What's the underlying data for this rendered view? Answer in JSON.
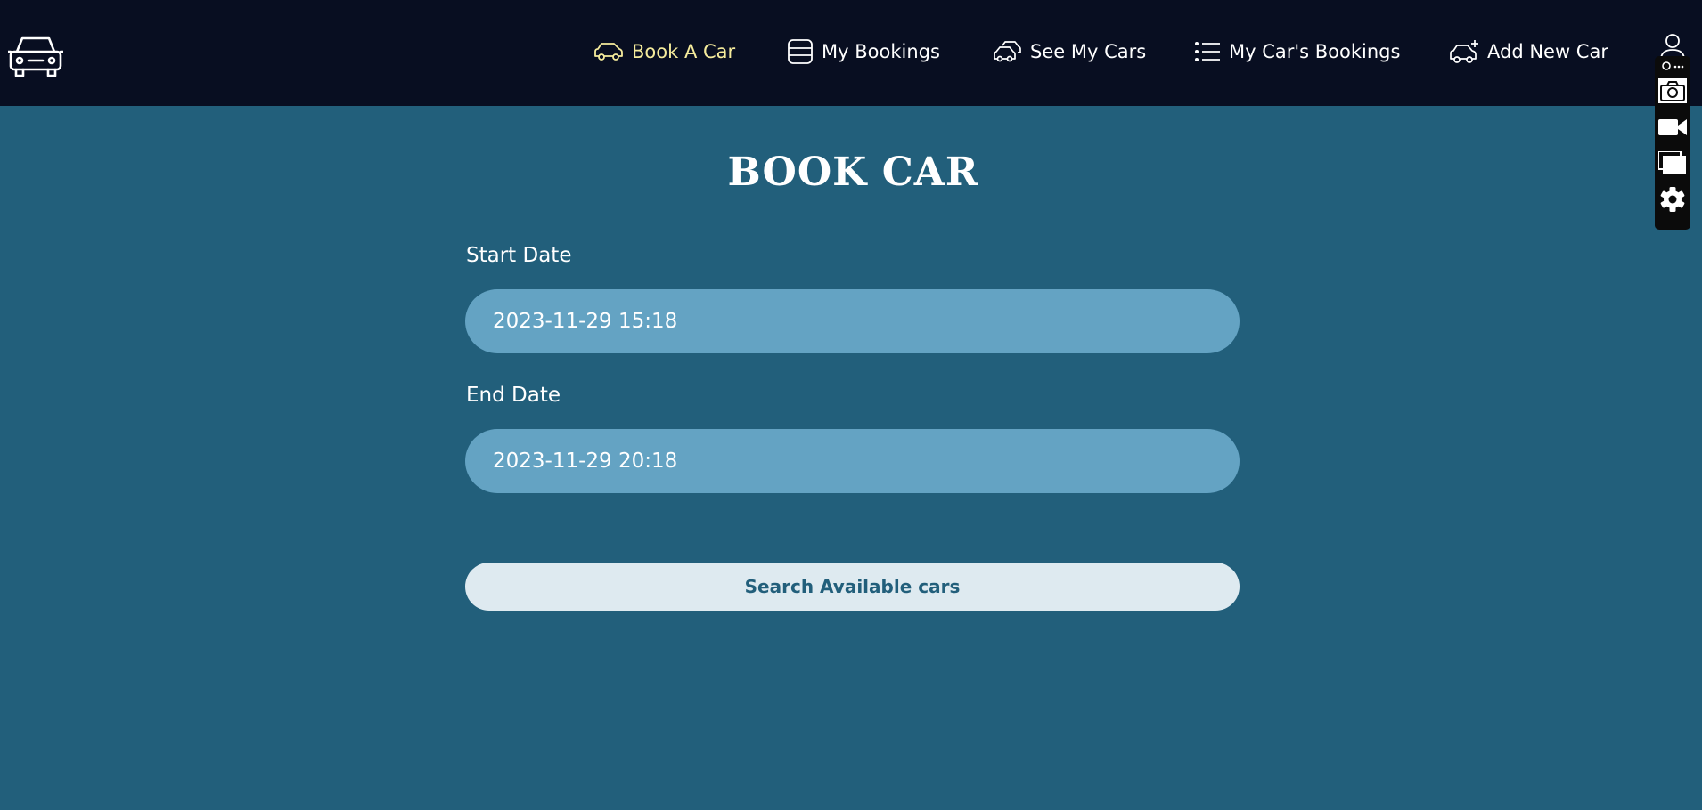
{
  "nav": {
    "items": [
      {
        "label": "Book A Car",
        "icon": "car-icon",
        "active": true
      },
      {
        "label": "My Bookings",
        "icon": "list-box-icon",
        "active": false
      },
      {
        "label": "See My Cars",
        "icon": "cars-icon",
        "active": false
      },
      {
        "label": "My Car's Bookings",
        "icon": "bullet-list-icon",
        "active": false
      },
      {
        "label": "Add New Car",
        "icon": "car-plus-icon",
        "active": false
      }
    ]
  },
  "form": {
    "title": "BOOK CAR",
    "start_label": "Start Date",
    "start_value": "2023-11-29 15:18",
    "end_label": "End Date",
    "end_value": "2023-11-29 20:18",
    "search_label": "Search Available cars"
  },
  "tools": [
    "camera-icon",
    "video-icon",
    "windows-icon",
    "settings-icon"
  ],
  "colors": {
    "topbar": "#080e21",
    "page_background": "#225f7b",
    "active_nav": "#f5eb9c",
    "input_background": "#64a3c3",
    "button_background": "#deeaf0"
  }
}
